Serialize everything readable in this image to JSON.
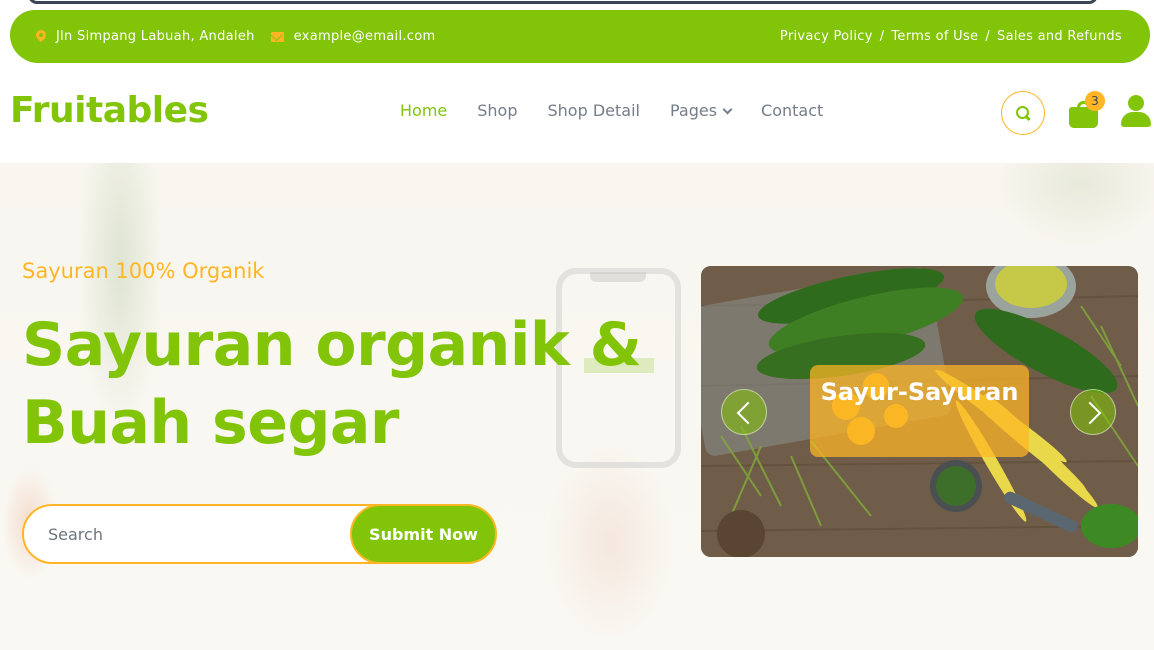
{
  "topbar": {
    "address": "Jln Simpang Labuah, Andaleh",
    "email": "example@email.com",
    "links": [
      "Privacy Policy",
      "Terms of Use",
      "Sales and Refunds"
    ],
    "separator": "/",
    "color": "#81c408",
    "icon_color": "#ffb524"
  },
  "navbar": {
    "logo": "Fruitables",
    "menu": [
      "Home",
      "Shop",
      "Shop Detail",
      "Pages",
      "Contact"
    ],
    "active": "Home",
    "cart_count": "3",
    "icons": [
      "search-icon",
      "shopping-bag-icon",
      "user-icon"
    ]
  },
  "hero": {
    "subtitle": "Sayuran 100% Organik",
    "title": "Sayuran organik & Buah segar",
    "search_placeholder": "Search",
    "submit_label": "Submit Now",
    "carousel_caption": "Sayur-Sayuran",
    "accent": "#ffb524"
  }
}
